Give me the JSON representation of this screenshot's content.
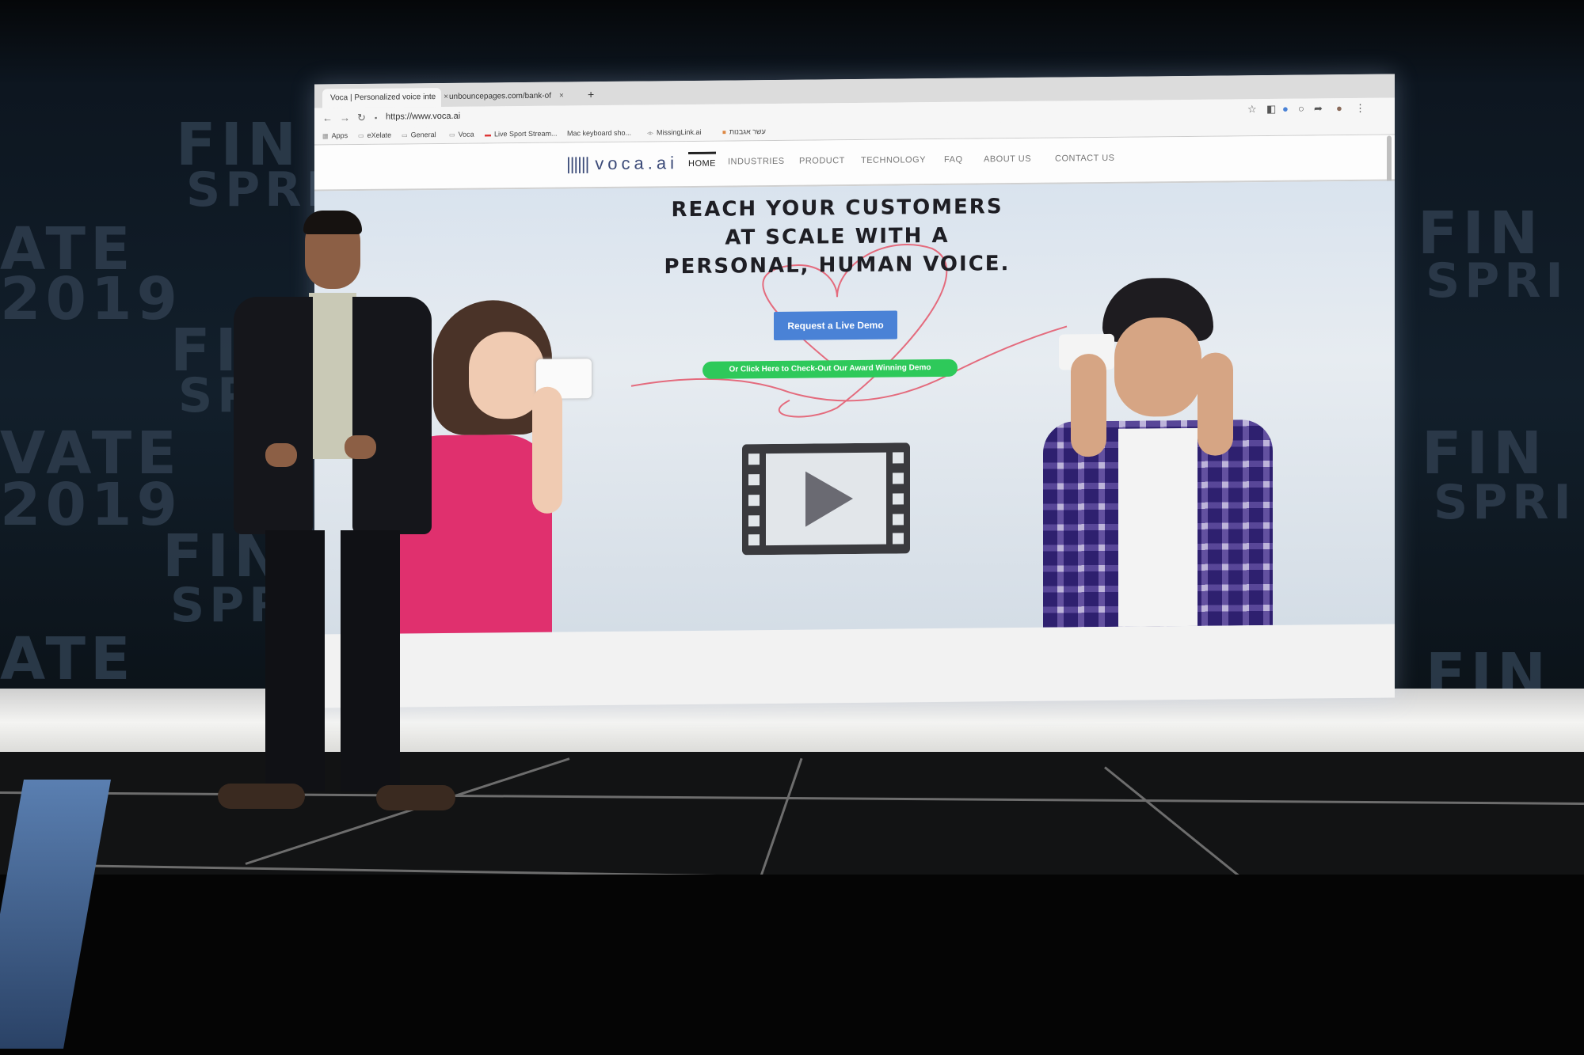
{
  "browser": {
    "tabs": [
      {
        "title": "Voca | Personalized voice inte",
        "close": "×"
      },
      {
        "title": "unbouncepages.com/bank-of",
        "close": "×"
      }
    ],
    "new_tab": "+",
    "url": "https://www.voca.ai",
    "bookmarks": [
      "Apps",
      "eXelate",
      "General",
      "Voca",
      "Live Sport Stream...",
      "Mac keyboard sho...",
      "MissingLink.ai",
      "עשר אגבנות"
    ]
  },
  "site": {
    "logo": "voca.ai",
    "nav": [
      "HOME",
      "INDUSTRIES",
      "PRODUCT",
      "TECHNOLOGY",
      "FAQ",
      "ABOUT US",
      "CONTACT US"
    ],
    "headline": [
      "REACH YOUR CUSTOMERS",
      "AT SCALE WITH A",
      "PERSONAL, HUMAN VOICE."
    ],
    "cta_button": "Request a Live Demo",
    "demo_link": "Or Click Here to Check-Out Our Award Winning Demo"
  },
  "backdrop": {
    "wall_text": [
      "FIN",
      "SPRI",
      "ATE",
      "2019",
      "FIN",
      "SPR",
      "VATE",
      "2019",
      "FIN",
      "SPR",
      "ATE",
      "FIN",
      "SPRI",
      "FIN",
      "SPRI",
      "FIN"
    ]
  },
  "colors": {
    "cta_blue": "#4a82d6",
    "demo_green": "#2ec95a",
    "logo_navy": "#3b4a78",
    "shirt_pink": "#e0306e"
  }
}
